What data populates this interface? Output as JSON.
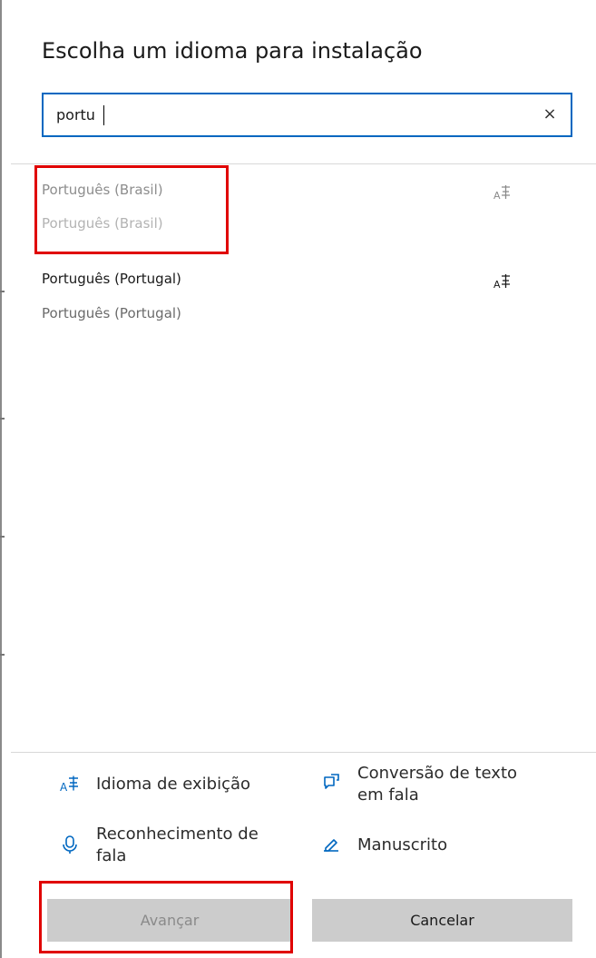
{
  "dialog": {
    "title": "Escolha um idioma para instalação"
  },
  "search": {
    "value": "portu",
    "clear_icon": "×"
  },
  "languages": [
    {
      "name": "Português (Brasil)",
      "native": "Português (Brasil)",
      "state": "disabled",
      "icon": "language-pack-icon"
    },
    {
      "name": "Português (Portugal)",
      "native": "Português (Portugal)",
      "state": "enabled",
      "icon": "language-pack-icon"
    }
  ],
  "features": [
    {
      "label_lines": [
        "Idioma de exibição"
      ],
      "icon": "display-language-icon"
    },
    {
      "label_lines": [
        "Conversão de texto",
        "em fala"
      ],
      "icon": "text-to-speech-icon"
    },
    {
      "label_lines": [
        "Reconhecimento de",
        "fala"
      ],
      "icon": "microphone-icon"
    },
    {
      "label_lines": [
        "Manuscrito"
      ],
      "icon": "handwriting-icon"
    }
  ],
  "buttons": {
    "next_label": "Avançar",
    "cancel_label": "Cancelar"
  },
  "colors": {
    "accent": "#0067c0",
    "highlight": "#e00000",
    "feature_icon": "#0067c0",
    "button_bg": "#cccccc"
  }
}
